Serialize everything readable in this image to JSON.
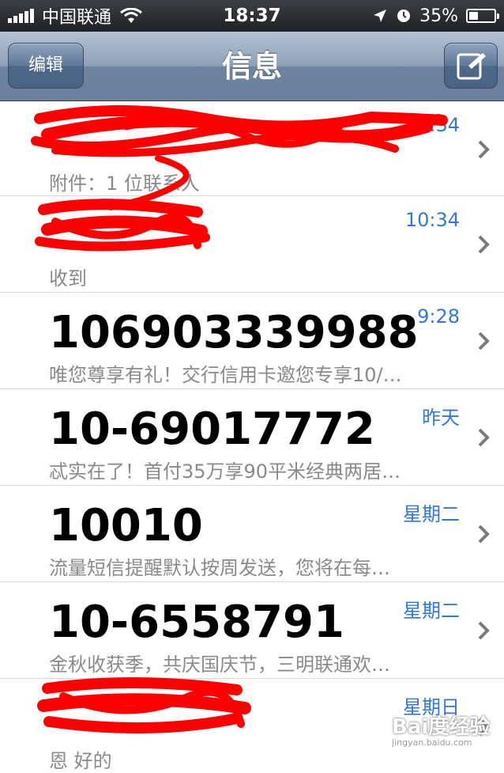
{
  "status_bar": {
    "carrier": "中国联通",
    "time": "18:37",
    "battery": "35%",
    "battery_level": 0.35
  },
  "nav": {
    "title": "信息",
    "edit_label": "编辑",
    "compose_icon": "compose-icon"
  },
  "conversations": [
    {
      "sender": "",
      "timestamp": "10:34",
      "preview": "附件：1 位联系人",
      "redacted": true
    },
    {
      "sender": "",
      "timestamp": "10:34",
      "preview": "收到",
      "redacted": true
    },
    {
      "sender": "106903339988",
      "timestamp": "9:28",
      "preview": "唯您尊享有礼！交行信用卡邀您专享10/…"
    },
    {
      "sender": "10-69017772",
      "timestamp": "昨天",
      "preview": "忒实在了！首付35万享90平米经典两居…"
    },
    {
      "sender": "10010",
      "timestamp": "星期二",
      "preview": "流量短信提醒默认按周发送，您将在每…"
    },
    {
      "sender": "10-6558791",
      "timestamp": "星期二",
      "preview": "金秋收获季，共庆国庆节，三明联通欢…"
    },
    {
      "sender": "",
      "timestamp": "星期日",
      "preview": "恩 好的",
      "redacted": true
    }
  ],
  "watermark": {
    "text": "Bai度经验",
    "sub": "jingyan.baidu.com"
  },
  "colors": {
    "accent": "#3478d6",
    "redaction": "#ff0000"
  }
}
